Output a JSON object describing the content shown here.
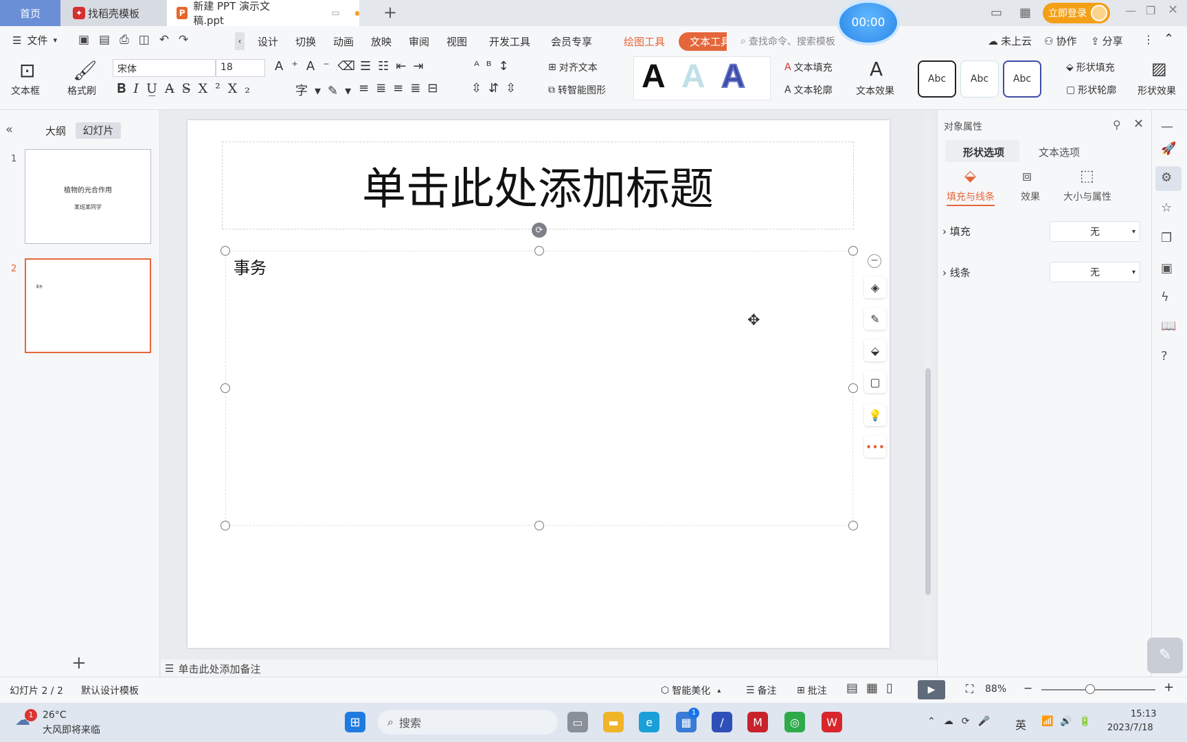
{
  "titlebar": {
    "tab_home": "首页",
    "tab_template": "找稻壳模板",
    "tab_doc": "新建 PPT 演示文稿.ppt",
    "new_tab": "+",
    "login": "立即登录",
    "timer": "00:00"
  },
  "menubar": {
    "file": "文件",
    "tabs": [
      "设计",
      "切换",
      "动画",
      "放映",
      "审阅",
      "视图",
      "开发工具",
      "会员专享"
    ],
    "draw_tool": "绘图工具",
    "text_tool": "文本工具",
    "search_placeholder": "查找命令、搜索模板",
    "cloud": "未上云",
    "collab": "协作",
    "share": "分享"
  },
  "ribbon": {
    "textbox": "文本框",
    "format_painter": "格式刷",
    "font_name": "宋体",
    "font_size": "18",
    "align_text": "对齐文本",
    "smart_shape": "转智能图形",
    "text_fill": "文本填充",
    "text_outline": "文本轮廓",
    "text_effect": "文本效果",
    "abc": "Abc",
    "shape_fill": "形状填充",
    "shape_outline": "形状轮廓",
    "shape_effect": "形状效果",
    "bigA": "A"
  },
  "leftpane": {
    "outline": "大纲",
    "slides": "幻灯片",
    "slide1_num": "1",
    "slide1_title": "植物的光合作用",
    "slide1_sub": "某班某同学",
    "slide2_num": "2",
    "slide2_text": "事务",
    "add": "+"
  },
  "slide": {
    "title": "单击此处添加标题",
    "body": "事务"
  },
  "notes": "单击此处添加备注",
  "rightpanel": {
    "header": "对象属性",
    "tab_shape": "形状选项",
    "tab_text": "文本选项",
    "sub_fill_line": "填充与线条",
    "sub_effect": "效果",
    "sub_size": "大小与属性",
    "fill_label": "填充",
    "fill_value": "无",
    "line_label": "线条",
    "line_value": "无"
  },
  "statusbar": {
    "slide_pos": "幻灯片 2 / 2",
    "template": "默认设计模板",
    "beautify": "智能美化",
    "notes": "备注",
    "comment": "批注",
    "zoom": "88%"
  },
  "taskbar": {
    "temp": "26°C",
    "weather": "大风即将来临",
    "badge": "1",
    "search": "搜索",
    "lang": "英",
    "time": "15:13",
    "date": "2023/7/18"
  },
  "colors": {
    "accent": "#e5663a",
    "home_tab": "#6a8fd6",
    "login": "#f3a017"
  }
}
